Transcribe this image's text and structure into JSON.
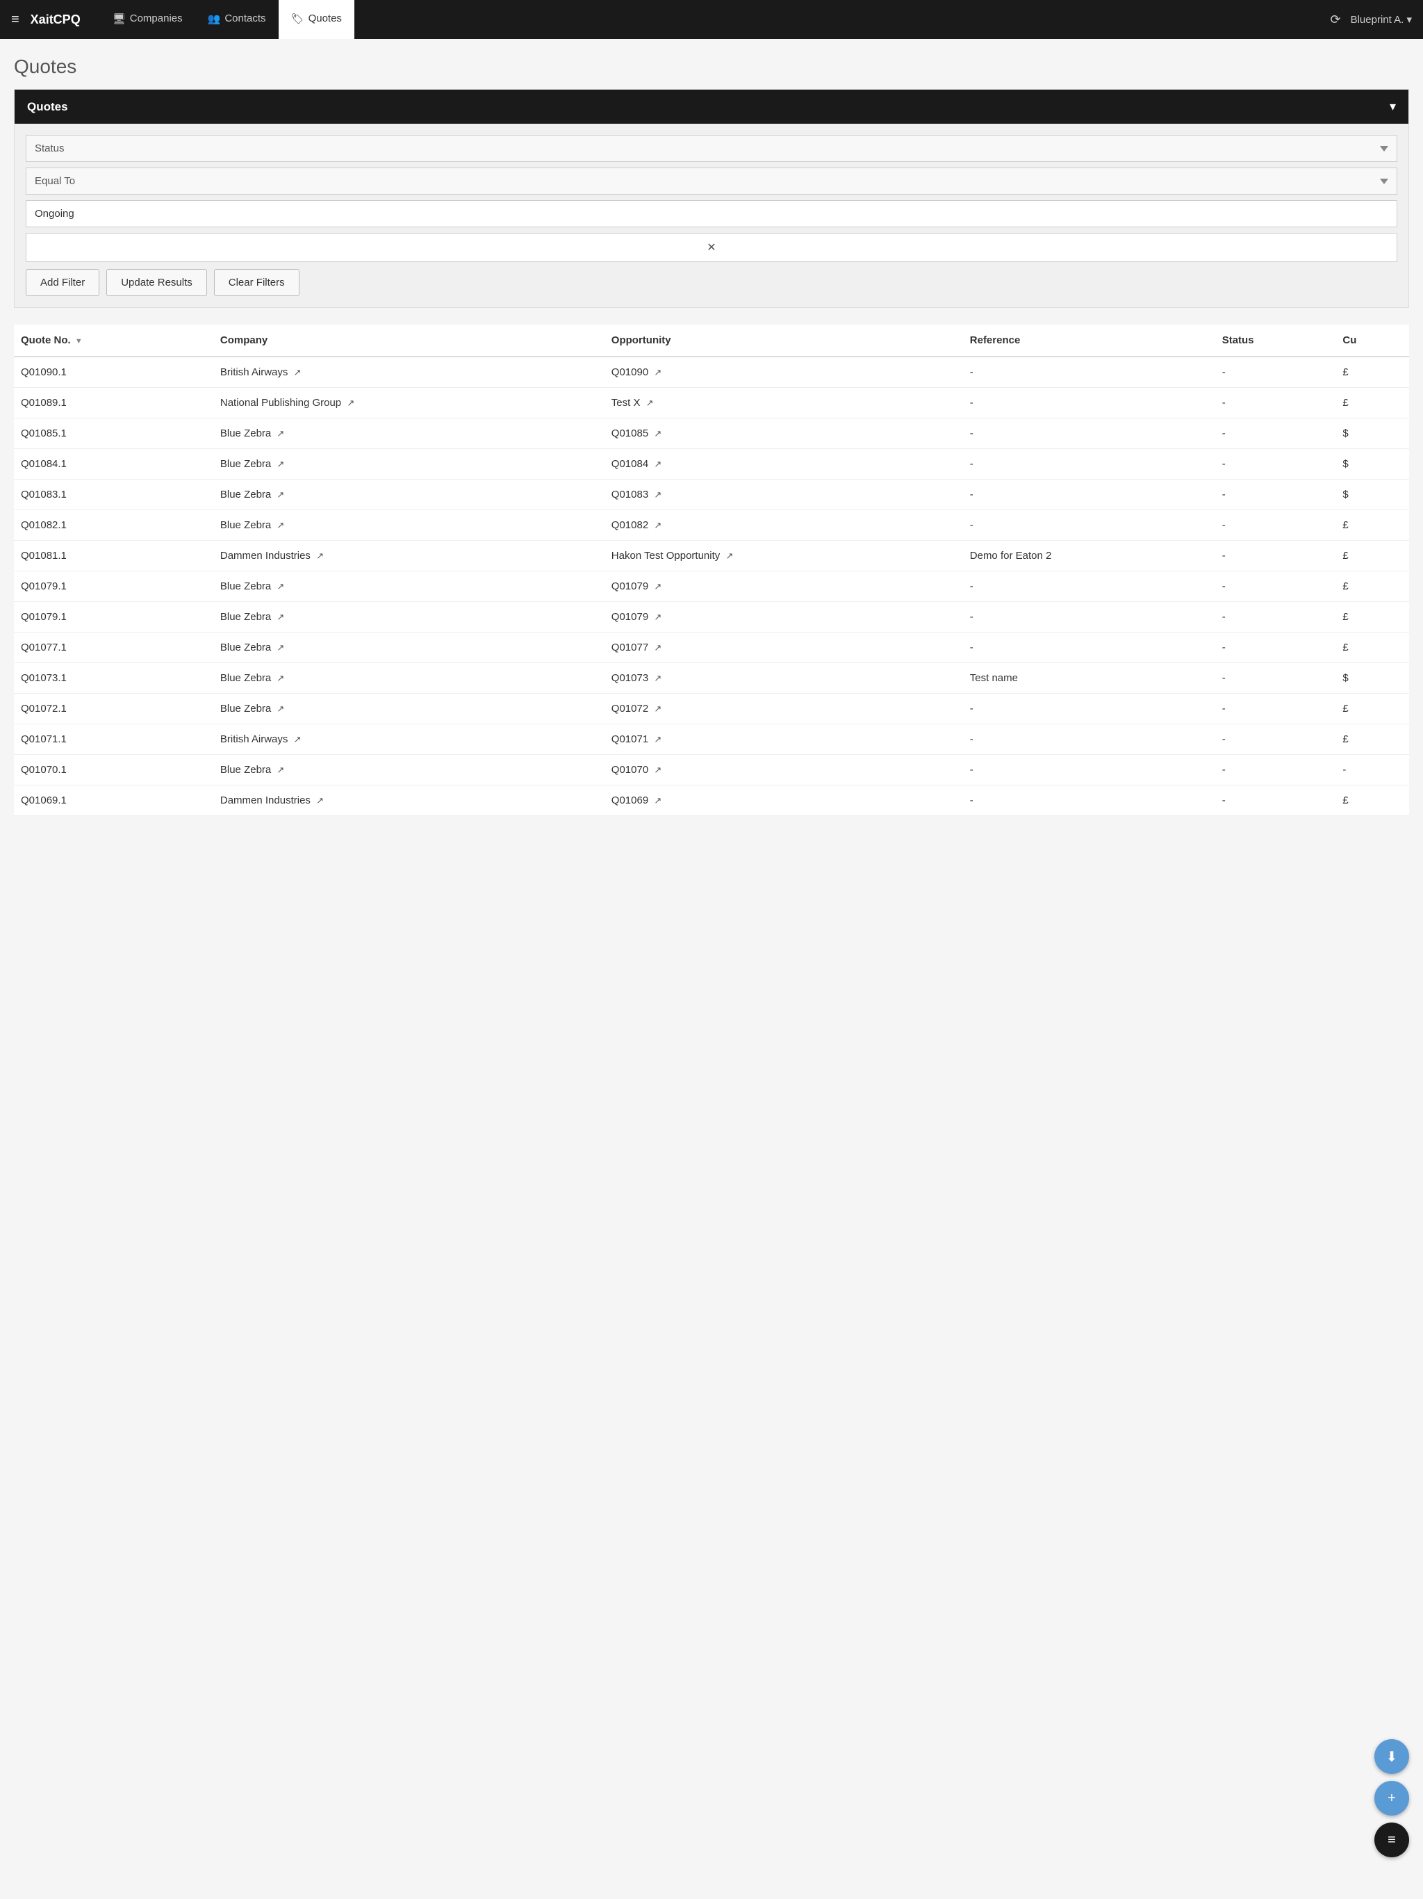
{
  "navbar": {
    "brand": "XaitCPQ",
    "hamburger_icon": "≡",
    "items": [
      {
        "id": "companies",
        "label": "Companies",
        "icon": "🖥",
        "active": false
      },
      {
        "id": "contacts",
        "label": "Contacts",
        "icon": "👥",
        "active": false
      },
      {
        "id": "quotes",
        "label": "Quotes",
        "icon": "🏷",
        "active": true
      }
    ],
    "refresh_icon": "⟳",
    "account_label": "Blueprint A.",
    "account_chevron": "▾"
  },
  "page": {
    "title": "Quotes"
  },
  "panel": {
    "title": "Quotes",
    "chevron": "▾"
  },
  "filters": {
    "status_label": "Status",
    "equal_to_label": "Equal To",
    "ongoing_value": "Ongoing",
    "clear_symbol": "✕",
    "buttons": {
      "add_filter": "Add Filter",
      "update_results": "Update Results",
      "clear_filters": "Clear Filters"
    }
  },
  "table": {
    "columns": [
      "Quote No.",
      "Company",
      "Opportunity",
      "Reference",
      "Status",
      "Cu"
    ],
    "rows": [
      {
        "quote_no": "Q01090.1",
        "company": "British Airways",
        "opportunity": "Q01090",
        "reference": "-",
        "status": "-",
        "currency": "£"
      },
      {
        "quote_no": "Q01089.1",
        "company": "National Publishing Group",
        "opportunity": "Test X",
        "reference": "-",
        "status": "-",
        "currency": "£"
      },
      {
        "quote_no": "Q01085.1",
        "company": "Blue Zebra",
        "opportunity": "Q01085",
        "reference": "-",
        "status": "-",
        "currency": "$"
      },
      {
        "quote_no": "Q01084.1",
        "company": "Blue Zebra",
        "opportunity": "Q01084",
        "reference": "-",
        "status": "-",
        "currency": "$"
      },
      {
        "quote_no": "Q01083.1",
        "company": "Blue Zebra",
        "opportunity": "Q01083",
        "reference": "-",
        "status": "-",
        "currency": "$"
      },
      {
        "quote_no": "Q01082.1",
        "company": "Blue Zebra",
        "opportunity": "Q01082",
        "reference": "-",
        "status": "-",
        "currency": "£"
      },
      {
        "quote_no": "Q01081.1",
        "company": "Dammen Industries",
        "opportunity": "Hakon Test Opportunity",
        "reference": "Demo for Eaton 2",
        "status": "-",
        "currency": "£"
      },
      {
        "quote_no": "Q01079.1",
        "company": "Blue Zebra",
        "opportunity": "Q01079",
        "reference": "-",
        "status": "-",
        "currency": "£"
      },
      {
        "quote_no": "Q01079.1",
        "company": "Blue Zebra",
        "opportunity": "Q01079",
        "reference": "-",
        "status": "-",
        "currency": "£"
      },
      {
        "quote_no": "Q01077.1",
        "company": "Blue Zebra",
        "opportunity": "Q01077",
        "reference": "-",
        "status": "-",
        "currency": "£"
      },
      {
        "quote_no": "Q01073.1",
        "company": "Blue Zebra",
        "opportunity": "Q01073",
        "reference": "Test name",
        "status": "-",
        "currency": "$"
      },
      {
        "quote_no": "Q01072.1",
        "company": "Blue Zebra",
        "opportunity": "Q01072",
        "reference": "-",
        "status": "-",
        "currency": "£"
      },
      {
        "quote_no": "Q01071.1",
        "company": "British Airways",
        "opportunity": "Q01071",
        "reference": "-",
        "status": "-",
        "currency": "£"
      },
      {
        "quote_no": "Q01070.1",
        "company": "Blue Zebra",
        "opportunity": "Q01070",
        "reference": "-",
        "status": "-",
        "currency": "-"
      },
      {
        "quote_no": "Q01069.1",
        "company": "Dammen Industries",
        "opportunity": "Q01069",
        "reference": "-",
        "status": "-",
        "currency": "£"
      }
    ]
  },
  "fabs": {
    "download_icon": "⬇",
    "add_icon": "+",
    "menu_icon": "≡"
  }
}
